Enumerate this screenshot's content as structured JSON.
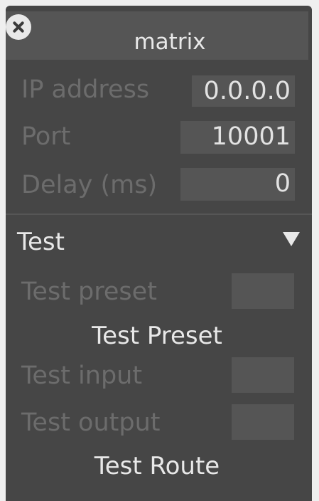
{
  "window": {
    "title": "matrix",
    "close_icon": "close-icon"
  },
  "settings": {
    "ip_label": "IP address",
    "ip_value": "0.0.0.0",
    "port_label": "Port",
    "port_value": "10001",
    "delay_label": "Delay (ms)",
    "delay_value": "0"
  },
  "test_section": {
    "title": "Test",
    "collapse_icon": "triangle-down-icon",
    "preset_label": "Test preset",
    "preset_button": "Test Preset",
    "input_label": "Test input",
    "output_label": "Test output",
    "route_button": "Test Route"
  },
  "colors": {
    "panel_bg": "#464646",
    "field_bg": "#555555",
    "label_text": "#6c6c6c",
    "bright_text": "#e8e8e8",
    "page_bg": "#efefef"
  }
}
